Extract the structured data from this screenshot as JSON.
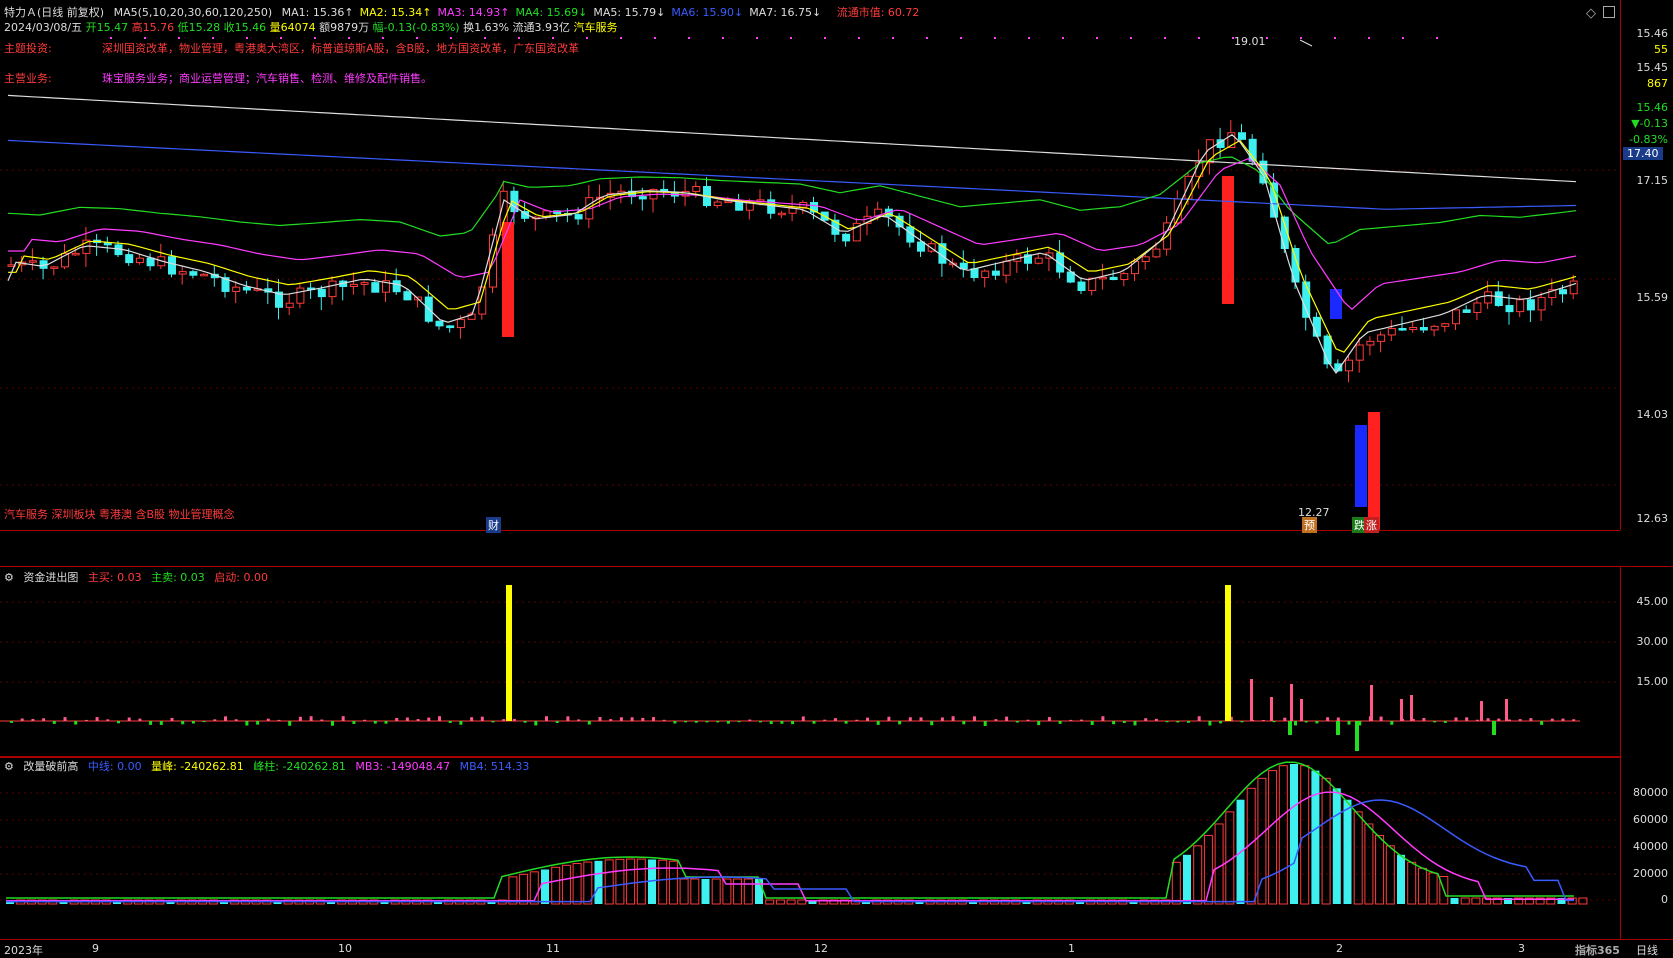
{
  "main": {
    "title": "特力Ａ(日线 前复权)",
    "ma_params": "MA5(5,10,20,30,60,120,250)",
    "ma": [
      {
        "label": "MA1: 15.36",
        "color": "#dddddd",
        "arrow": "↑"
      },
      {
        "label": "MA2: 15.34",
        "color": "#ffff00",
        "arrow": "↑"
      },
      {
        "label": "MA3: 14.93",
        "color": "#ff3cff",
        "arrow": "↑"
      },
      {
        "label": "MA4: 15.69",
        "color": "#22dd22",
        "arrow": "↓"
      },
      {
        "label": "MA5: 15.79",
        "color": "#dddddd",
        "arrow": "↓"
      },
      {
        "label": "MA6: 15.90",
        "color": "#3a5cff",
        "arrow": "↓"
      },
      {
        "label": "MA7: 16.75",
        "color": "#dddddd",
        "arrow": "↓"
      }
    ],
    "mkt_cap": "流通市值: 60.72",
    "quote_date": "2024/03/08/五",
    "quote_open": "开15.47",
    "quote_high": "高15.76",
    "quote_low": "低15.28",
    "quote_close": "收15.46",
    "quote_vol": "量64074",
    "quote_amt": "额9879万",
    "quote_chg": "幅-0.13(-0.83%)",
    "quote_turn": "换1.63%",
    "quote_float": "流通3.93亿",
    "quote_industry": "汽车服务",
    "theme_label": "主题投资:",
    "theme_text": "深圳国资改革，物业管理，粤港奥大湾区，标普道琼斯A股，含B股，地方国资改革，广东国资改革",
    "biz_label": "主营业务:",
    "biz_text": "珠宝服务业务；商业运营管理；汽车销售、检测、维修及配件销售。",
    "concepts": "汽车服务 深圳板块 粤港澳 含B股 物业管理概念",
    "high_mark": "19.01",
    "low_mark": "12.27",
    "tag_cai": "财",
    "tag_yu": "预",
    "tag_die": "跌",
    "tag_zhang": "涨"
  },
  "axis_main": {
    "labels": [
      "15.46",
      "55",
      "15.45",
      "867",
      "15.46",
      "▼-0.13",
      "-0.83%",
      "17.40",
      "17.15",
      "15.59",
      "14.03",
      "12.63"
    ],
    "price_ticks": [
      "17.15",
      "15.59",
      "14.03",
      "12.63"
    ]
  },
  "sub1": {
    "title": "资金进出图",
    "buy": "主买: 0.03",
    "sell": "主卖: 0.03",
    "start": "启动: 0.00",
    "ticks": [
      "45.00",
      "30.00",
      "15.00"
    ]
  },
  "sub2": {
    "title": "改量破前高",
    "mid": "中线: 0.00",
    "peak": "量峰: -240262.81",
    "peak_col": "峰柱: -240262.81",
    "mb3": "MB3: -149048.47",
    "mb4": "MB4: 514.33",
    "ticks": [
      "80000",
      "60000",
      "40000",
      "20000",
      "0"
    ]
  },
  "x_axis": {
    "labels": [
      "2023年",
      "9",
      "10",
      "11",
      "12",
      "1",
      "2",
      "3"
    ],
    "period": "日线",
    "brand": "指标365"
  },
  "colors": {
    "up": "#ff3b3b",
    "down": "#3ef0f0",
    "bg": "#000000",
    "grid": "#aa0000"
  }
}
